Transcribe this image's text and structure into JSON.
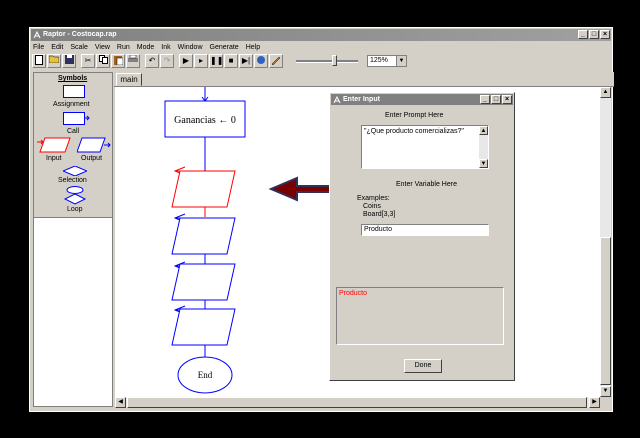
{
  "window": {
    "title": "Raptor - Costocap.rap"
  },
  "menu": [
    "File",
    "Edit",
    "Scale",
    "View",
    "Run",
    "Mode",
    "Ink",
    "Window",
    "Generate",
    "Help"
  ],
  "toolbar": {
    "zoom": "125%"
  },
  "palette": {
    "heading": "Symbols",
    "assignment": "Assignment",
    "call": "Call",
    "input": "Input",
    "output": "Output",
    "selection": "Selection",
    "loop": "Loop"
  },
  "tabs": [
    "main"
  ],
  "flowchart": {
    "assignment_text": "Ganancias ← 0",
    "end_text": "End"
  },
  "dialog": {
    "title": "Enter Input",
    "prompt_label": "Enter Prompt Here",
    "prompt_value": "\"¿Que producto comercializas?\"",
    "variable_label": "Enter Variable Here",
    "examples_label": "Examples:",
    "example1": "Coins",
    "example2": "Board[3,3]",
    "variable_value": "Producto",
    "output_text": "Producto",
    "done_label": "Done"
  },
  "colors": {
    "flow_blue": "#0000ff",
    "selected_red": "#ff0000",
    "arrow_red": "#7a0000"
  }
}
